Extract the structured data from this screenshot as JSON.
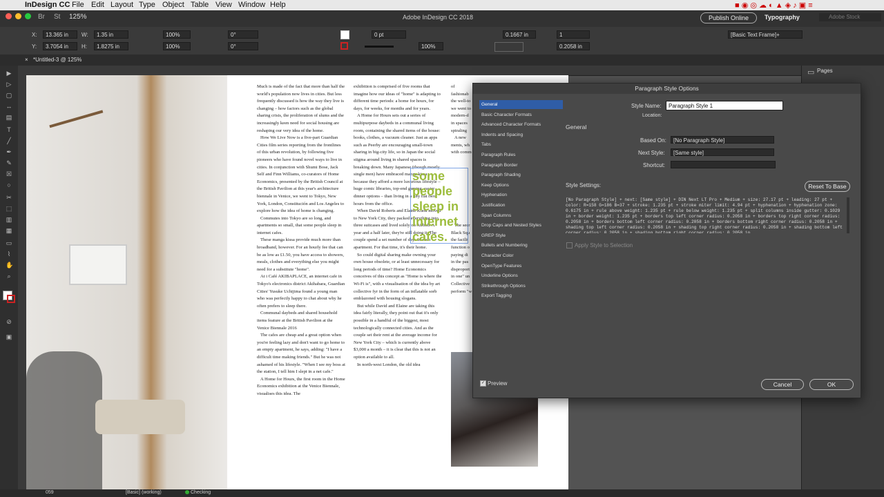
{
  "menubar": {
    "app_name": "InDesign CC",
    "items": [
      "File",
      "Edit",
      "Layout",
      "Type",
      "Object",
      "Table",
      "View",
      "Window",
      "Help"
    ]
  },
  "titlebar": {
    "zoom": "125%",
    "title": "Adobe InDesign CC 2018",
    "publish_online": "Publish Online",
    "workspace": "Typography",
    "search_placeholder": "Adobe Stock"
  },
  "control_panel": {
    "x": "13.365 in",
    "y": "3.7054 in",
    "w": "1.35 in",
    "h": "1.8275 in",
    "scale_x": "100%",
    "scale_y": "100%",
    "angle": "0°",
    "shear": "0°",
    "stroke_weight": "0 pt",
    "opacity": "100%",
    "offset": "0.1667 in",
    "columns": "1",
    "gutter": "0.2058 in",
    "object_style": "[Basic Text Frame]+"
  },
  "tab": {
    "label": "*Untitled-3 @ 125%"
  },
  "panels": {
    "pages": "Pages"
  },
  "statusbar": {
    "page": "059",
    "master": "[Basic] (working)",
    "preflight": "Checking"
  },
  "document": {
    "col1": "Much is made of the fact that more than half the world's population now lives in cities. But less frequently discussed is how the way they live is changing – how factors such as the global sharing crisis, the proliferation of slums and the increasingly keen need for social housing are reshaping our very idea of the home.\n   How We Live Now is a five-part Guardian Cities film series reporting from the frontlines of this urban revolution, by following five pioneers who have found novel ways to live in cities. In conjunction with Shumi Bose, Jack Self and Finn Williams, co-curators of Home Economics, presented by the British Council at the British Pavilion at this year's architecture biennale in Venice, we went to Tokyo, New York, London, Constitución and Los Angeles to explore how the idea of home is changing.\n   Commutes into Tokyo are so long, and apartments so small, that some people sleep in internet cafes.\n   These manga kissa provide much more than broadband, however. For an hourly fee that can be as low as £1.50, you have access to showers, meals, clothes and everything else you might need for a substitute \"home\".\n   At i Café AKIBAPLACE, an internet cafe in Tokyo's electronics district Akihabara, Guardian Cities' Yusuke Uchijima found a young man who was perfectly happy to chat about why he often prefers to sleep there.\n   Communal daybeds and shared household items feature at the British Pavilion at the Venice Biennale 2016\n   The cafes are cheap and a great option when you're feeling lazy and don't want to go home to an empty apartment, he says, adding: \"I have a difficult time making friends.\" But he was not ashamed of his lifestyle. \"When I see my boss at the station, I tell him I slept in a net cafe.\"\n   A Home for Hours, the first room in the Home Economics exhibition at the Venice Biennale, visualises this idea. The",
    "col2": "exhibition is comprised of five rooms that imagine how our ideas of \"home\" is adapting to different time periods: a home for hours, for days, for weeks, for months and for years.\n   A Home for Hours sets out a series of multipurpose daybeds in a communal living room, containing the shared items of the house: books, clothes, a vacuum cleaner. Just as apps such as Peerby are encouraging small-town sharing in big-city life, so in Japan the social stigma around living in shared spaces is breaking down. Many Japanese (though mostly single men) have embraced manga kissa because they afford a more luxurious lifestyle – huge comic libraries, top-end gaming, easier dinner options – than living in a tiny flat two hours from the office.\n   When David Roberts and Elaine Kuok moved to New York City, they packed everything into three suitcases and lived solely on Airbnb. A year and a half later, they're still doing it. The couple spend a set number of days in each apartment. For that time, it's their home.\n   So could digital sharing make owning your own house obsolete, or at least unnecessary for long periods of time? Home Economics conceives of this concept as \"Home is where the Wi-Fi is\", with a visualisation of the idea by art collective fyr in the form of an inflatable sorb emblazoned with housing slogans.\n   But while David and Elaine are taking this idea fairly literally, they point out that it's only possible in a handful of the biggest, most technologically connected cities. And as the couple set their rent at the average income for New York City – which is currently above $3,000 a month – it is clear that this is not an option available to all.\n   In north-west London, the old idea",
    "col3": "of fashionab\nthe well-to\nwe went to\nmodern-d\nin spaces\nspiraling\n   A new\nments, wh\nwith comm\n\n\n\n\n\n\n\n\n\n   The secr\nBlack Squ\nthe facilit\nfunction o\npaying di\nin the pas\ndisproport\nin one\" un\nCollective\nperform \"w",
    "frame_text": "some people sleep in internet cafes."
  },
  "dialog": {
    "title": "Paragraph Style Options",
    "categories": [
      "General",
      "Basic Character Formats",
      "Advanced Character Formats",
      "Indents and Spacing",
      "Tabs",
      "Paragraph Rules",
      "Paragraph Border",
      "Paragraph Shading",
      "Keep Options",
      "Hyphenation",
      "Justification",
      "Span Columns",
      "Drop Caps and Nested Styles",
      "GREP Style",
      "Bullets and Numbering",
      "Character Color",
      "OpenType Features",
      "Underline Options",
      "Strikethrough Options",
      "Export Tagging"
    ],
    "selected_category": "General",
    "style_name_label": "Style Name:",
    "style_name_value": "Paragraph Style 1",
    "location_label": "Location:",
    "section_title": "General",
    "based_on_label": "Based On:",
    "based_on_value": "[No Paragraph Style]",
    "next_style_label": "Next Style:",
    "next_style_value": "[Same style]",
    "shortcut_label": "Shortcut:",
    "style_settings_label": "Style Settings:",
    "reset_button": "Reset To Base",
    "settings_text": "[No Paragraph Style] + next: [Same style] + DIN Next LT Pro + Medium + size: 27.17 pt + leading: 27 pt + color: R=158 G=186 B=37 + stroke: 1.235 pt + stroke miter limit: 4.94 pt + hyphenation + hyphenation zone: 0.6175 in + rule above weight: 1.235 pt + rule below weight: 1.235 pt + split columns inside gutter: 0.1029 in + border weight: 1.235 pt + borders top left corner radius: 0.2058 in + borders top right corner radius: 0.2058 in + borders bottom left corner radius: 0.2058 in + borders bottom right corner radius: 0.2058 in + shading top left corner radius: 0.2058 in + shading top right corner radius: 0.2058 in + shading bottom left corner radius: 0.2058 in + shading bottom right corner radius: 0.2058 in",
    "apply_label": "Apply Style to Selection",
    "preview_label": "Preview",
    "cancel": "Cancel",
    "ok": "OK"
  },
  "colors": {
    "accent": "#2f5da7",
    "frame_text": "#9dbd3d"
  }
}
